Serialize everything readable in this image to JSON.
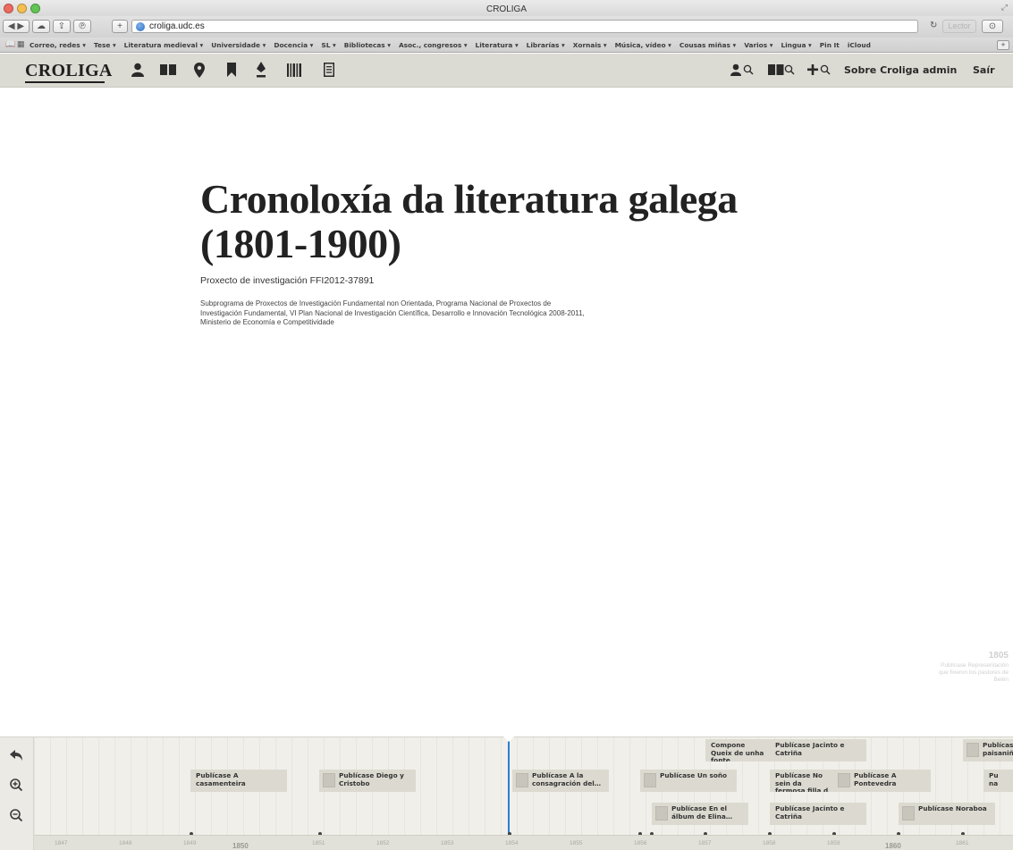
{
  "browser": {
    "window_title": "CROLIGA",
    "address": "croliga.udc.es",
    "reader_label": "Lector",
    "bookmarks": [
      "Correo, redes ▾",
      "Tese ▾",
      "Literatura medieval ▾",
      "Universidade ▾",
      "Docencia ▾",
      "SL ▾",
      "Bibliotecas ▾",
      "Asoc., congresos ▾",
      "Literatura ▾",
      "Librarías ▾",
      "Xornais ▾",
      "Música, vídeo ▾",
      "Cousas miñas ▾",
      "Varios ▾",
      "Lingua ▾",
      "Pin It",
      "iCloud"
    ]
  },
  "site": {
    "logo": "CROLIGA",
    "links": {
      "about": "Sobre Croliga",
      "admin": "admin",
      "logout": "Saír"
    }
  },
  "main": {
    "title": "Cronoloxía da literatura galega (1801-1900)",
    "project": "Proxecto de investigación FFI2012-37891",
    "funding": "Subprograma de Proxectos de Investigación Fundamental non Orientada, Programa Nacional de Proxectos de Investigación Fundamental, VI Plan Nacional de Investigación Científica, Desarrollo e Innovación Tecnológica 2008-2011, Ministerio de Economía e Competitividade"
  },
  "side_date": {
    "year": "1805",
    "text": "Publícase Representación que fixeron los pastores de Belén"
  },
  "timeline": {
    "events": [
      {
        "text": "Publícase A casamenteira",
        "thumb": false
      },
      {
        "text": "Publícase Diego y Cristobo",
        "thumb": true
      },
      {
        "text": "Publícase A la consagración del…",
        "thumb": true
      },
      {
        "text": "Publícase Un soño",
        "thumb": true
      },
      {
        "text": "Publícase En el álbum de Elina…",
        "thumb": true
      },
      {
        "text": "Compone Queix de unha fonte",
        "thumb": false
      },
      {
        "text": "Publícase Jacinto e Catriña",
        "thumb": false
      },
      {
        "text": "Publícase No sein da fermosa filla d",
        "thumb": false
      },
      {
        "text": "Publícase A Pontevedra",
        "thumb": true
      },
      {
        "text": "Publícase Jacinto e Catriña",
        "thumb": false
      },
      {
        "text": "Publícase Noraboa",
        "thumb": true
      },
      {
        "text": "Publícase paisaniña",
        "thumb": true
      },
      {
        "text": "Pu na",
        "thumb": false
      }
    ],
    "years": [
      "1847",
      "1848",
      "1849",
      "1851",
      "1852",
      "1853",
      "1854",
      "1855",
      "1856",
      "1857",
      "1858",
      "1859",
      "1861"
    ],
    "eras": [
      "1850",
      "1860"
    ]
  }
}
